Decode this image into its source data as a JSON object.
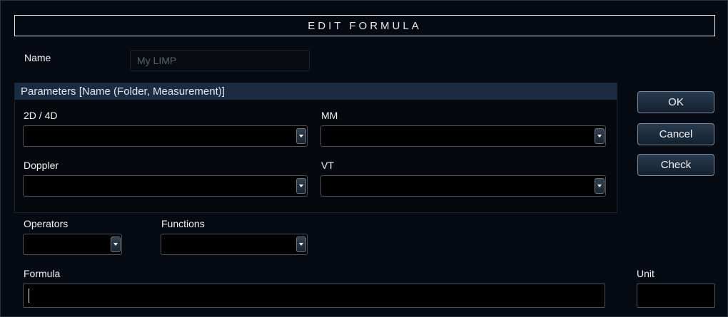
{
  "dialog": {
    "title": "EDIT FORMULA"
  },
  "name": {
    "label": "Name",
    "value": "My LIMP"
  },
  "parameters": {
    "header": "Parameters  [Name (Folder, Measurement)]",
    "fields": [
      {
        "label": "2D / 4D",
        "value": ""
      },
      {
        "label": "MM",
        "value": ""
      },
      {
        "label": "Doppler",
        "value": ""
      },
      {
        "label": "VT",
        "value": ""
      }
    ]
  },
  "operators": {
    "label": "Operators",
    "value": ""
  },
  "functions": {
    "label": "Functions",
    "value": ""
  },
  "formula": {
    "label": "Formula",
    "value": ""
  },
  "unit": {
    "label": "Unit",
    "value": ""
  },
  "buttons": {
    "ok": "OK",
    "cancel": "Cancel",
    "check": "Check"
  },
  "icons": {
    "dropdown_arrow": "chevron-down-icon"
  },
  "colors": {
    "background": "#000000",
    "header_bar": "#1b2c42",
    "button_gradient_top": "#2a3b50",
    "button_border": "#7f8d9b",
    "disabled_text": "#5b626b"
  }
}
